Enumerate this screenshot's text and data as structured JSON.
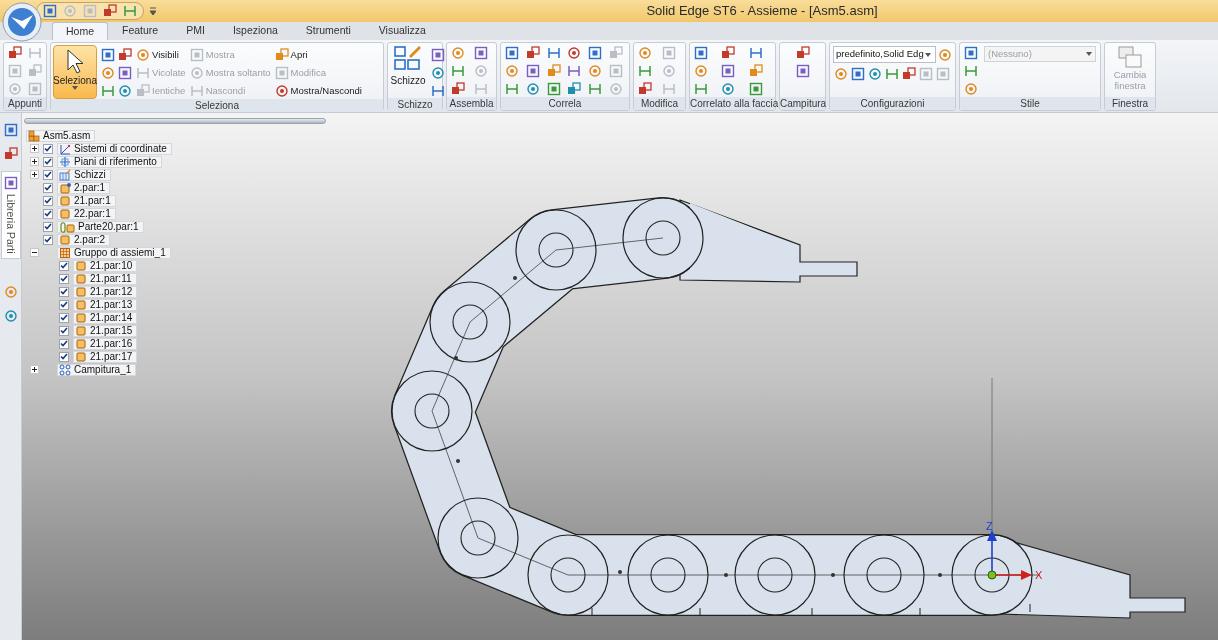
{
  "window": {
    "title": "Solid Edge ST6 - Assieme - [Asm5.asm]"
  },
  "tabs": [
    {
      "label": "Home",
      "selected": true
    },
    {
      "label": "Feature",
      "selected": false
    },
    {
      "label": "PMI",
      "selected": false
    },
    {
      "label": "Ispeziona",
      "selected": false
    },
    {
      "label": "Strumenti",
      "selected": false
    },
    {
      "label": "Visualizza",
      "selected": false
    }
  ],
  "ribbon": {
    "groups": [
      {
        "kind": "clipboard",
        "label": "Appunti"
      },
      {
        "kind": "selection",
        "label": "Seleziona",
        "big": {
          "label": "Seleziona",
          "selected": true
        },
        "buttons": [
          {
            "label": "Visibili",
            "disabled": false
          },
          {
            "label": "Vicolate",
            "disabled": true
          },
          {
            "label": "Ientiche",
            "disabled": true
          },
          {
            "label": "Mostra",
            "disabled": true
          },
          {
            "label": "Mostra soltanto",
            "disabled": true
          },
          {
            "label": "Nascondi",
            "disabled": true
          },
          {
            "label": "Apri",
            "disabled": false
          },
          {
            "label": "Modifica",
            "disabled": true
          },
          {
            "label": "Mostra/Nascondi",
            "disabled": false
          }
        ]
      },
      {
        "kind": "sketch",
        "label": "Schizzo",
        "big": {
          "label": "Schizzo"
        }
      },
      {
        "kind": "assemble",
        "label": "Assembla"
      },
      {
        "kind": "relate",
        "label": "Correla"
      },
      {
        "kind": "modify",
        "label": "Modifica"
      },
      {
        "kind": "face",
        "label": "Correlato alla faccia"
      },
      {
        "kind": "hatch",
        "label": "Campitura"
      },
      {
        "kind": "config",
        "label": "Configurazioni",
        "value": "predefinito,Solid Edg"
      },
      {
        "kind": "style",
        "label": "Stile",
        "value": "(Nessuno)",
        "disabled": true
      },
      {
        "kind": "window",
        "label": "Finestra",
        "big": {
          "label": "Cambia finestra",
          "disabled": true
        }
      }
    ]
  },
  "side_tabs": [
    {
      "label": "Libreria Parti"
    }
  ],
  "tree": {
    "root": {
      "label": "Asm5.asm",
      "kind": "assembly",
      "children": [
        {
          "label": "Sistemi di coordinate",
          "kind": "coords",
          "checked": true,
          "expanded": false
        },
        {
          "label": "Piani di riferimento",
          "kind": "planes",
          "checked": true,
          "expanded": false
        },
        {
          "label": "Schizzi",
          "kind": "sketches",
          "checked": true,
          "expanded": false
        },
        {
          "label": "2.par:1",
          "kind": "part-edit",
          "checked": true
        },
        {
          "label": "21.par:1",
          "kind": "part",
          "checked": true
        },
        {
          "label": "22.par:1",
          "kind": "part",
          "checked": true
        },
        {
          "label": "Parte20.par:1",
          "kind": "part-linked",
          "checked": true
        },
        {
          "label": "2.par:2",
          "kind": "part",
          "checked": true
        },
        {
          "label": "Gruppo di assiemi_1",
          "kind": "group",
          "expanded": true,
          "children": [
            {
              "label": "21.par:10",
              "kind": "part",
              "checked": true
            },
            {
              "label": "21.par:11",
              "kind": "part",
              "checked": true
            },
            {
              "label": "21.par:12",
              "kind": "part",
              "checked": true
            },
            {
              "label": "21.par:13",
              "kind": "part",
              "checked": true
            },
            {
              "label": "21.par:14",
              "kind": "part",
              "checked": true
            },
            {
              "label": "21.par:15",
              "kind": "part",
              "checked": true
            },
            {
              "label": "21.par:16",
              "kind": "part",
              "checked": true
            },
            {
              "label": "21.par:17",
              "kind": "part",
              "checked": true
            }
          ]
        },
        {
          "label": "Campitura_1",
          "kind": "hatch",
          "expanded": false
        }
      ]
    }
  },
  "viewport": {
    "axes": [
      {
        "kind": "z",
        "label": "Z"
      },
      {
        "kind": "x",
        "label": "X"
      }
    ]
  }
}
